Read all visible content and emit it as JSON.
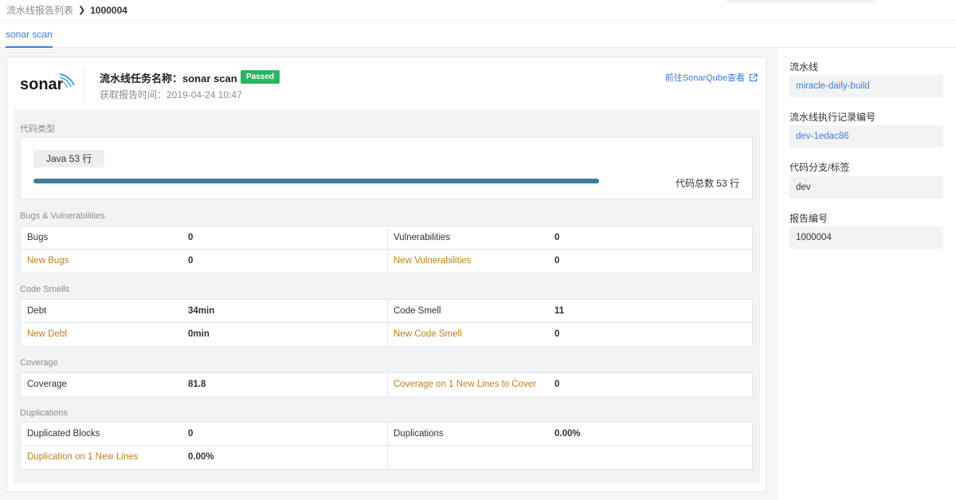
{
  "breadcrumb": {
    "parent": "流水线报告列表",
    "current": "1000004"
  },
  "tabs": [
    {
      "label": "sonar scan",
      "active": true
    }
  ],
  "header": {
    "logo_text": "sonar",
    "task_title": "流水线任务名称：sonar scan",
    "status_badge": "Passed",
    "fetch_time": "获取报告时间：2019-04-24 10:47",
    "sonarqube_link": "前往SonarQube查看"
  },
  "languages": {
    "section_label": "代码类型",
    "items": [
      {
        "label": "Java 53 行",
        "fraction": 1.0
      }
    ],
    "total": "代码总数 53 行"
  },
  "bugs": {
    "section_label": "Bugs & Vulnerabilities",
    "rows": [
      {
        "k1": "Bugs",
        "v1": "0",
        "k2": "Vulnerabilities",
        "v2": "0",
        "new1": false,
        "new2": false
      },
      {
        "k1": "New Bugs",
        "v1": "0",
        "k2": "New Vulnerabilities",
        "v2": "0",
        "new1": true,
        "new2": true
      }
    ]
  },
  "smells": {
    "section_label": "Code Smells",
    "rows": [
      {
        "k1": "Debt",
        "v1": "34min",
        "k2": "Code Smell",
        "v2": "11",
        "new1": false,
        "new2": false
      },
      {
        "k1": "New Debt",
        "v1": "0min",
        "k2": "New Code Smell",
        "v2": "0",
        "new1": true,
        "new2": true
      }
    ]
  },
  "coverage": {
    "section_label": "Coverage",
    "rows": [
      {
        "k1": "Coverage",
        "v1": "81.8",
        "k2": "Coverage on 1 New Lines to Cover",
        "v2": "0",
        "new1": false,
        "new2": true
      }
    ]
  },
  "duplications": {
    "section_label": "Duplications",
    "rows": [
      {
        "k1": "Duplicated Blocks",
        "v1": "0",
        "k2": "Duplications",
        "v2": "0.00%",
        "new1": false,
        "new2": false
      },
      {
        "k1": "Duplication on 1 New Lines",
        "v1": "0.00%",
        "k2": "",
        "v2": "",
        "new1": true,
        "new2": false
      }
    ]
  },
  "sidebar": {
    "pipeline_label": "流水线",
    "pipeline_value": "miracle-daily-build",
    "record_label": "流水线执行记录编号",
    "record_value": "dev-1edac86",
    "branch_label": "代码分支/标签",
    "branch_value": "dev",
    "report_label": "报告编号",
    "report_value": "1000004"
  },
  "colors": {
    "accent": "#3a7bd5",
    "passed": "#2cb560",
    "new_metric": "#c07f1c",
    "bar": "#3e7c99"
  }
}
